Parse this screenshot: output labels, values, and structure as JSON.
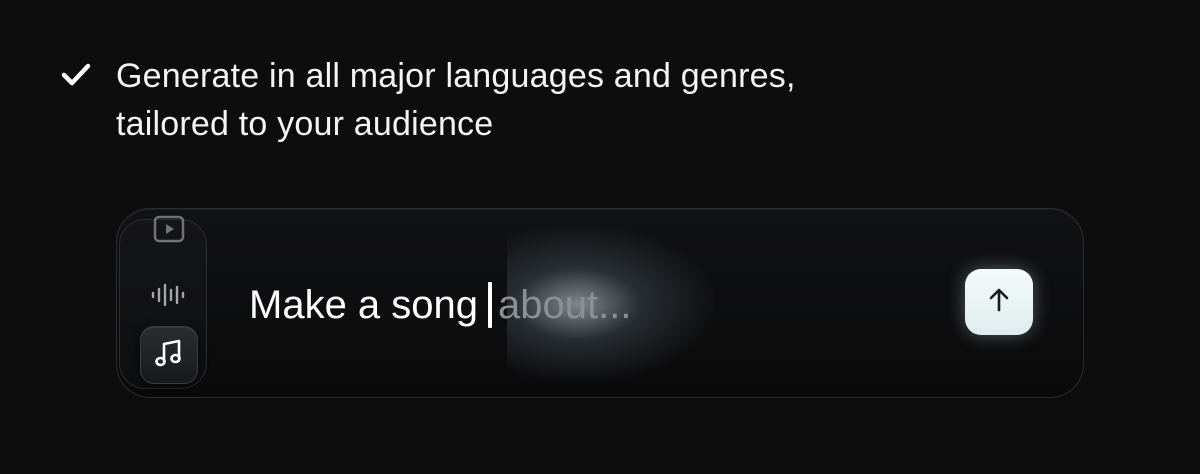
{
  "feature": {
    "line1": "Generate in all major languages and genres,",
    "line2": "tailored to your audience"
  },
  "prompt": {
    "typed": "Make a song",
    "placeholder": "about..."
  },
  "modes": [
    {
      "icon": "video-icon",
      "active": false
    },
    {
      "icon": "waveform-icon",
      "active": false
    },
    {
      "icon": "music-note-icon",
      "active": true
    }
  ],
  "colors": {
    "background": "#0d0d0d",
    "send_button": "#eaf6f6",
    "placeholder": "#8c8f95"
  }
}
